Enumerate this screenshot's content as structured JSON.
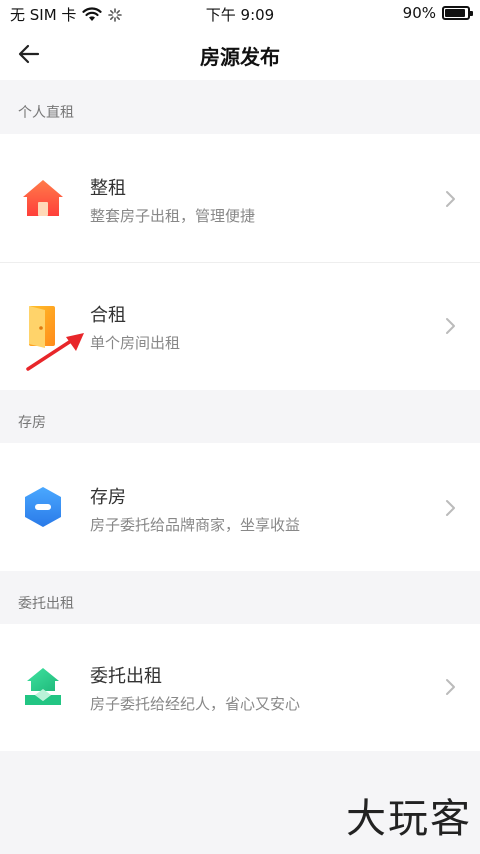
{
  "status_bar": {
    "carrier": "无 SIM 卡",
    "time": "下午 9:09",
    "battery": "90%",
    "battery_level": 0.9
  },
  "nav": {
    "title": "房源发布"
  },
  "sections": [
    {
      "header": "个人直租",
      "items": [
        {
          "title": "整租",
          "subtitle": "整套房子出租，管理便捷",
          "icon": "house-icon",
          "color": "#ff5a3c"
        },
        {
          "title": "合租",
          "subtitle": "单个房间出租",
          "icon": "door-icon",
          "color": "#ffa020"
        }
      ]
    },
    {
      "header": "存房",
      "items": [
        {
          "title": "存房",
          "subtitle": "房子委托给品牌商家，坐享收益",
          "icon": "hexagon-icon",
          "color": "#2e8cf0"
        }
      ]
    },
    {
      "header": "委托出租",
      "items": [
        {
          "title": "委托出租",
          "subtitle": "房子委托给经纪人，省心又安心",
          "icon": "house-handshake-icon",
          "color": "#2fcf8e"
        }
      ]
    }
  ],
  "watermark": "大玩客"
}
